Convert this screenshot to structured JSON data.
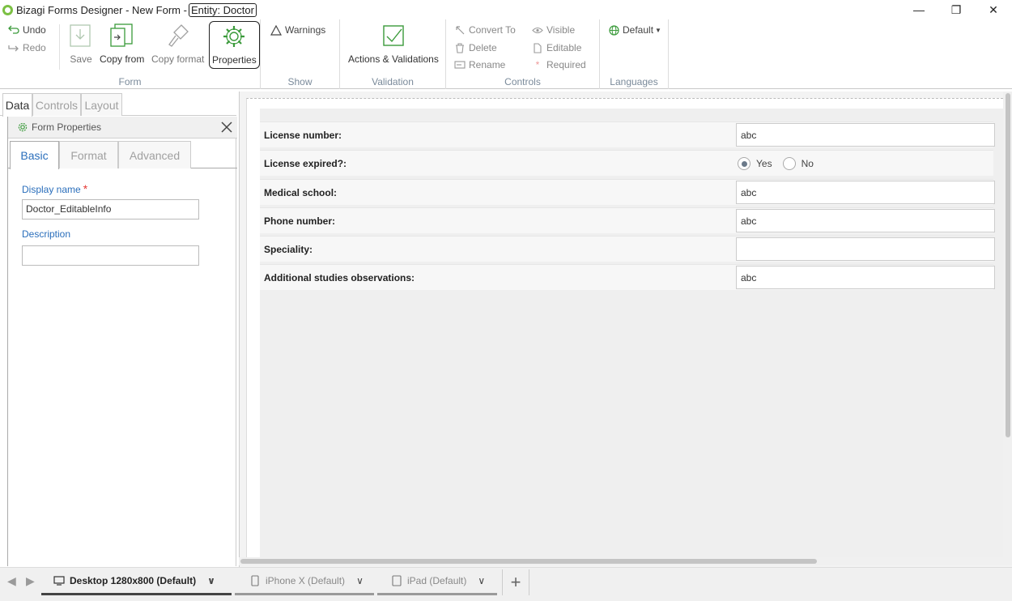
{
  "window": {
    "title": "Bizagi Forms Designer  - New Form -",
    "entity": "Entity:  Doctor",
    "minimize": "—",
    "restore": "❐",
    "close": "✕"
  },
  "ribbon": {
    "form_group": {
      "label": "Form",
      "undo": "Undo",
      "redo": "Redo",
      "save": "Save",
      "copy_from": "Copy from",
      "copy_format": "Copy format",
      "properties": "Properties"
    },
    "show_group": {
      "label": "Show",
      "warnings": "Warnings"
    },
    "validation_group": {
      "label": "Validation",
      "actions_validations": "Actions & Validations"
    },
    "controls_group": {
      "label": "Controls",
      "convert_to": "Convert To",
      "delete": "Delete",
      "rename": "Rename",
      "visible": "Visible",
      "editable": "Editable",
      "required": "Required"
    },
    "languages_group": {
      "label": "Languages",
      "default": "Default"
    }
  },
  "left_tabs": [
    "Data",
    "Controls",
    "Layout"
  ],
  "form_properties": {
    "title": "Form Properties",
    "tabs": [
      "Basic",
      "Format",
      "Advanced"
    ],
    "display_name_label": "Display name",
    "display_name_value": "Doctor_EditableInfo",
    "description_label": "Description",
    "description_value": ""
  },
  "form_rows": [
    {
      "label": "License number:",
      "type": "text",
      "value": "abc"
    },
    {
      "label": "License expired?:",
      "type": "radio",
      "options": [
        "Yes",
        "No"
      ],
      "selected": "Yes"
    },
    {
      "label": "Medical school:",
      "type": "text",
      "value": "abc"
    },
    {
      "label": "Phone number:",
      "type": "text",
      "value": "abc"
    },
    {
      "label": "Speciality:",
      "type": "text",
      "value": ""
    },
    {
      "label": "Additional studies observations:",
      "type": "text",
      "value": "abc"
    }
  ],
  "devices": [
    {
      "label": "Desktop 1280x800 (Default)",
      "active": true
    },
    {
      "label": "iPhone X (Default)",
      "active": false
    },
    {
      "label": "iPad (Default)",
      "active": false
    }
  ],
  "colors": {
    "accent": "#2a6ebb",
    "required": "#e53935",
    "icon_green": "#3a9a3a"
  }
}
